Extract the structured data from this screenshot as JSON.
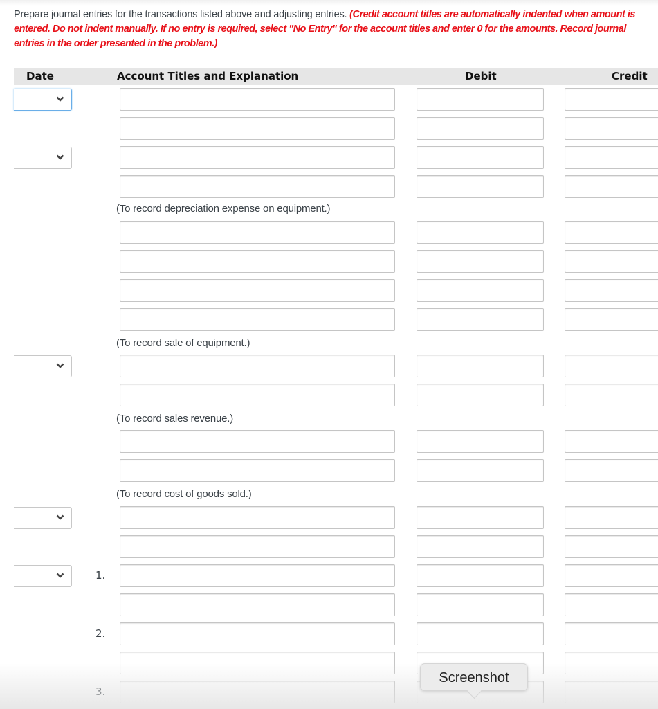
{
  "instructions": {
    "plain": "Prepare journal entries for the transactions listed above and adjusting entries. ",
    "emphasis": "(Credit account titles are automatically indented when amount is entered. Do not indent manually. If no entry is required, select \"No Entry\" for the account titles and enter 0 for the amounts. Record journal entries in the order presented in the problem.)"
  },
  "table": {
    "headers": {
      "date": "Date",
      "account": "Account Titles and Explanation",
      "debit": "Debit",
      "credit": "Credit"
    },
    "rows": [
      {
        "date_select": true,
        "focused": true,
        "number": "",
        "account": "",
        "debit": "",
        "credit": ""
      },
      {
        "date_select": false,
        "number": "",
        "account": "",
        "debit": "",
        "credit": ""
      },
      {
        "date_select": true,
        "number": "",
        "account": "",
        "debit": "",
        "credit": ""
      },
      {
        "date_select": false,
        "number": "",
        "account": "",
        "debit": "",
        "credit": ""
      },
      {
        "date_select": false,
        "number": "",
        "account": "",
        "debit": "",
        "credit": ""
      },
      {
        "date_select": false,
        "number": "",
        "account": "",
        "debit": "",
        "credit": ""
      },
      {
        "date_select": false,
        "number": "",
        "account": "",
        "debit": "",
        "credit": ""
      },
      {
        "date_select": false,
        "number": "",
        "account": "",
        "debit": "",
        "credit": ""
      },
      {
        "date_select": true,
        "number": "",
        "account": "",
        "debit": "",
        "credit": ""
      },
      {
        "date_select": false,
        "number": "",
        "account": "",
        "debit": "",
        "credit": ""
      },
      {
        "date_select": false,
        "number": "",
        "account": "",
        "debit": "",
        "credit": ""
      },
      {
        "date_select": false,
        "number": "",
        "account": "",
        "debit": "",
        "credit": ""
      },
      {
        "date_select": true,
        "number": "",
        "account": "",
        "debit": "",
        "credit": ""
      },
      {
        "date_select": false,
        "number": "",
        "account": "",
        "debit": "",
        "credit": ""
      },
      {
        "date_select": true,
        "number": "1.",
        "account": "",
        "debit": "",
        "credit": ""
      },
      {
        "date_select": false,
        "number": "",
        "account": "",
        "debit": "",
        "credit": ""
      },
      {
        "date_select": false,
        "number": "2.",
        "account": "",
        "debit": "",
        "credit": ""
      },
      {
        "date_select": false,
        "number": "",
        "account": "",
        "debit": "",
        "credit": ""
      },
      {
        "date_select": false,
        "number": "3.",
        "account": "",
        "debit": "",
        "credit": ""
      }
    ],
    "notes": [
      "(To record depreciation expense on equipment.)",
      "(To record sale of equipment.)",
      "(To record sales revenue.)",
      "(To record cost of goods sold.)"
    ]
  },
  "tooltip": {
    "label": "Screenshot"
  }
}
